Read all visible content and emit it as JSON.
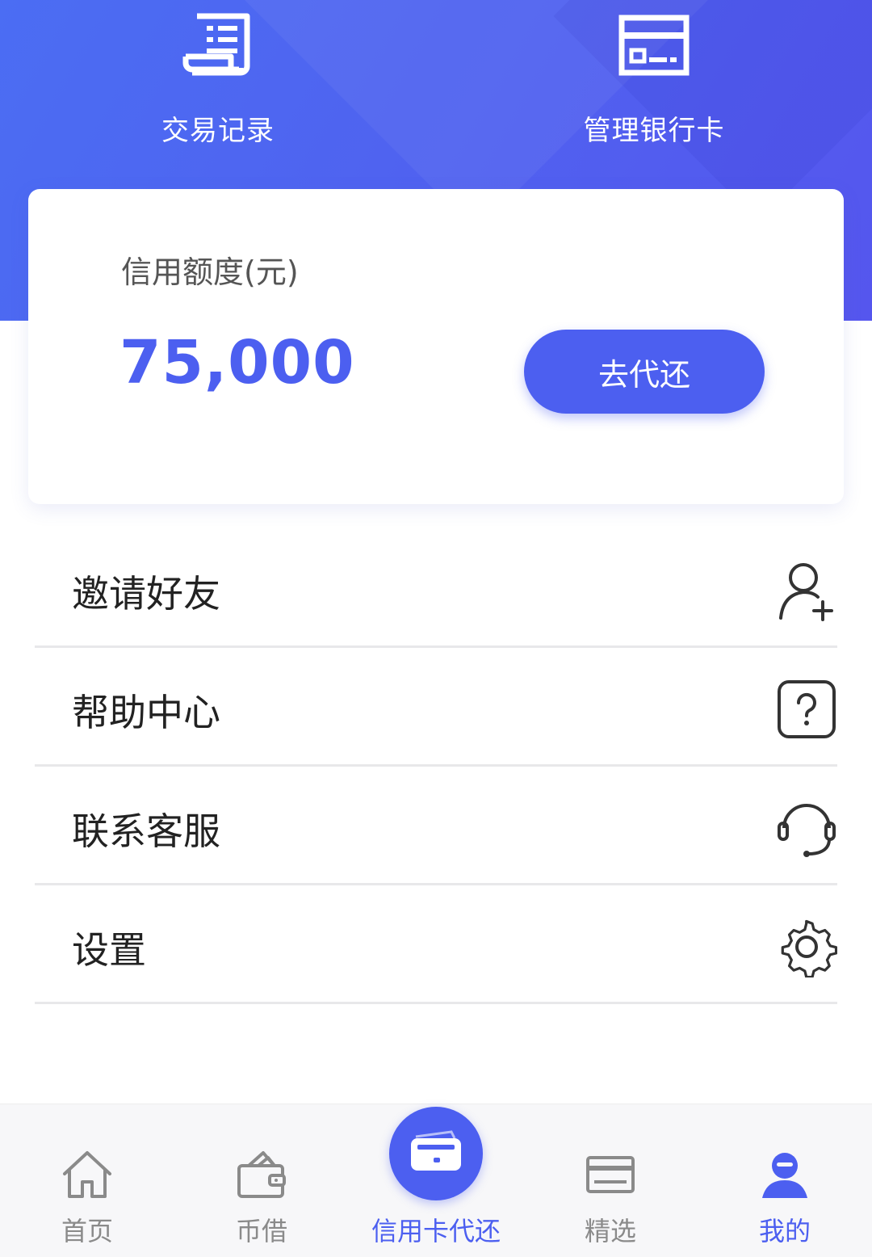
{
  "header": {
    "quick_actions": [
      {
        "label": "交易记录",
        "icon": "receipt-icon"
      },
      {
        "label": "管理银行卡",
        "icon": "bank-card-icon"
      }
    ]
  },
  "credit_card": {
    "label": "信用额度(元)",
    "amount": "75,000",
    "button_label": "去代还"
  },
  "menu": {
    "items": [
      {
        "label": "邀请好友",
        "icon": "add-user-icon"
      },
      {
        "label": "帮助中心",
        "icon": "help-icon"
      },
      {
        "label": "联系客服",
        "icon": "headset-icon"
      },
      {
        "label": "设置",
        "icon": "gear-icon"
      }
    ]
  },
  "bottom_nav": {
    "active": "我的",
    "items": [
      {
        "label": "首页",
        "icon": "home-icon"
      },
      {
        "label": "币借",
        "icon": "wallet-icon"
      },
      {
        "label": "信用卡代还",
        "icon": "credit-card-icon"
      },
      {
        "label": "精选",
        "icon": "card-list-icon"
      },
      {
        "label": "我的",
        "icon": "user-icon"
      }
    ]
  },
  "colors": {
    "accent": "#4c5ff0",
    "header_start": "#4b6df3",
    "header_end": "#5556ee",
    "inactive_text": "#8a8a8a"
  }
}
